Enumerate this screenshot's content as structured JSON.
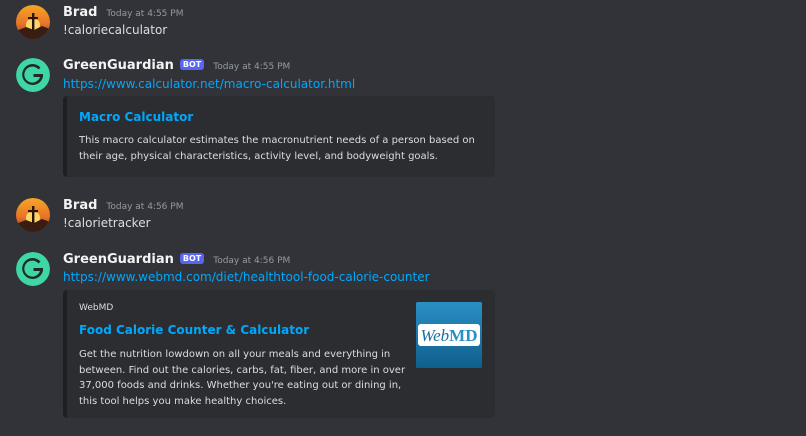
{
  "messages": [
    {
      "author": "Brad",
      "timestamp": "Today at 4:55 PM",
      "text": "!caloriecalculator"
    },
    {
      "author": "GreenGuardian",
      "bot_tag": "BOT",
      "timestamp": "Today at 4:55 PM",
      "link": "https://www.calculator.net/macro-calculator.html",
      "embed": {
        "title": "Macro Calculator",
        "description_lines": [
          "This macro calculator estimates the macronutrient needs of a person based on",
          "their age, physical characteristics, activity level, and bodyweight goals."
        ]
      }
    },
    {
      "author": "Brad",
      "timestamp": "Today at 4:56 PM",
      "text": "!calorietracker"
    },
    {
      "author": "GreenGuardian",
      "bot_tag": "BOT",
      "timestamp": "Today at 4:56 PM",
      "link": "https://www.webmd.com/diet/healthtool-food-calorie-counter",
      "embed": {
        "provider": "WebMD",
        "title": "Food Calorie Counter & Calculator",
        "description_lines": [
          "Get the nutrition lowdown on all your meals and everything in",
          "between. Find out the calories, carbs, fat, fiber, and more in over",
          "37,000 foods and drinks. Whether you're eating out or dining in,",
          "this tool helps you make healthy choices."
        ],
        "thumbnail_logo_text": "WebMD"
      }
    }
  ],
  "colors": {
    "background": "#313338",
    "embed_background": "#2b2d31",
    "link": "#00a8fc",
    "bot_tag": "#5865f2",
    "guardian_avatar": "#3fd6a5"
  },
  "icons": {
    "brad_avatar": "sunset-cross-avatar-icon",
    "guardian_avatar": "letter-g-avatar-icon"
  }
}
